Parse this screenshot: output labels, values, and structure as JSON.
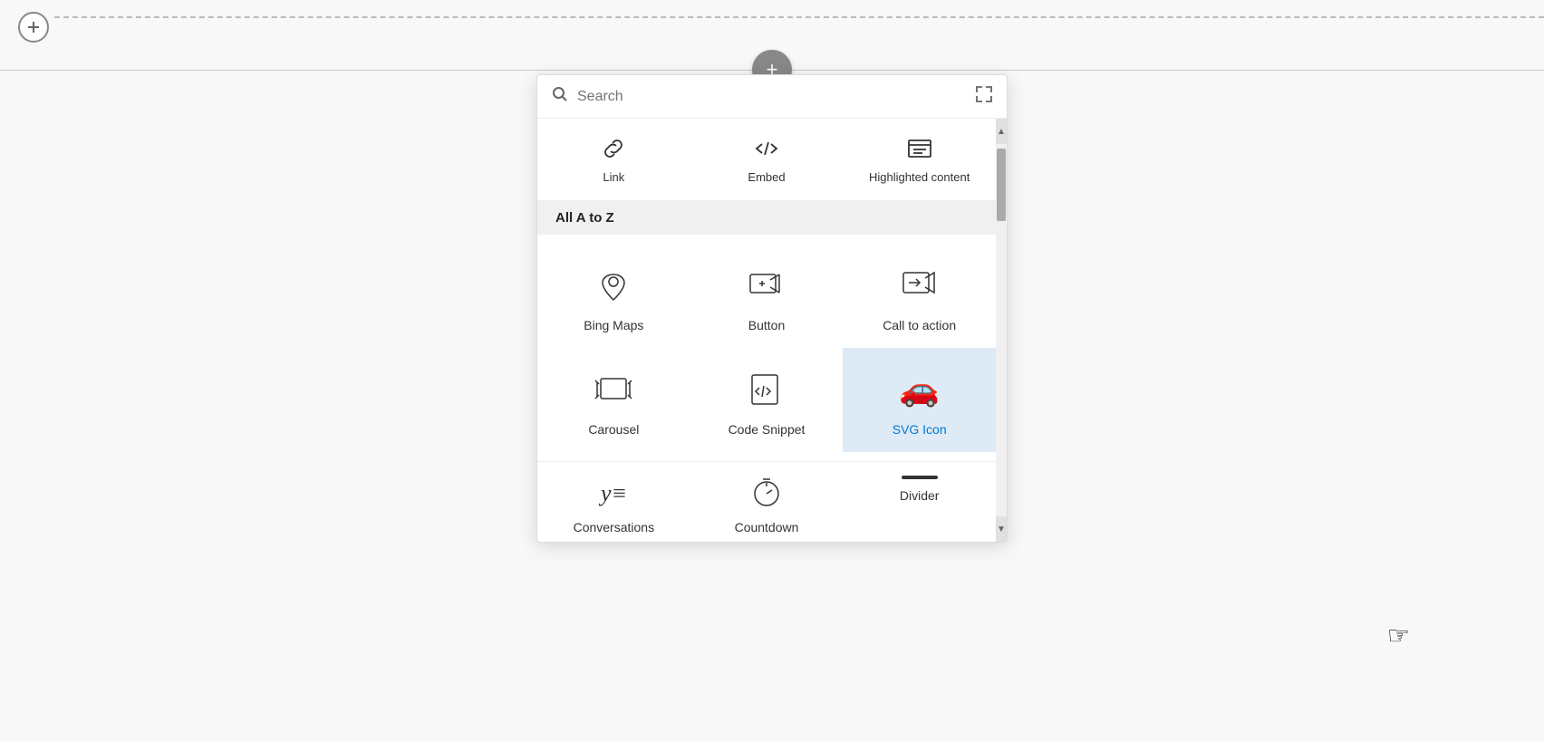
{
  "page": {
    "background": "#f8f8f8"
  },
  "top_add_button": {
    "label": "+",
    "aria": "Add block at top"
  },
  "center_add_button": {
    "label": "+",
    "aria": "Add block"
  },
  "search": {
    "placeholder": "Search",
    "value": "",
    "expand_label": "Expand"
  },
  "top_items": [
    {
      "label": "Link",
      "icon": "link-icon"
    },
    {
      "label": "Embed",
      "icon": "embed-icon"
    },
    {
      "label": "Highlighted content",
      "icon": "highlighted-content-icon"
    }
  ],
  "section_header": "All A to Z",
  "grid_items": [
    {
      "label": "Bing Maps",
      "icon": "bing-maps-icon",
      "selected": false
    },
    {
      "label": "Button",
      "icon": "button-icon",
      "selected": false
    },
    {
      "label": "Call to action",
      "icon": "call-to-action-icon",
      "selected": false
    },
    {
      "label": "Carousel",
      "icon": "carousel-icon",
      "selected": false
    },
    {
      "label": "Code Snippet",
      "icon": "code-snippet-icon",
      "selected": false
    },
    {
      "label": "SVG Icon",
      "icon": "svg-icon",
      "selected": true
    }
  ],
  "bottom_items": [
    {
      "label": "Conversations",
      "icon": "conversations-icon"
    },
    {
      "label": "Countdown",
      "icon": "countdown-icon"
    },
    {
      "label": "Divider",
      "icon": "divider-icon"
    }
  ]
}
